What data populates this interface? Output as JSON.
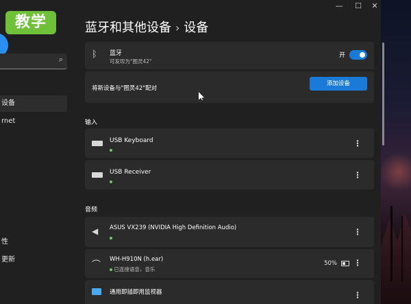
{
  "window": {
    "controls": {
      "minimize": "—",
      "maximize": "☐",
      "close": "✕"
    }
  },
  "badge": {
    "text": "教学",
    "color": "#6fc13a"
  },
  "sidebar": {
    "search_icon": "search-icon",
    "items": [
      {
        "label": "设备",
        "active": true
      },
      {
        "label": "rnet",
        "active": false
      },
      {
        "label": "性",
        "active": false
      },
      {
        "label": "更新",
        "active": false
      }
    ]
  },
  "breadcrumb": {
    "parent": "蓝牙和其他设备",
    "separator": "›",
    "current": "设备"
  },
  "bluetooth": {
    "icon": "bluetooth-icon",
    "title": "蓝牙",
    "subtitle": "可发现为\"图灵42\"",
    "toggle_label": "开",
    "toggle_on": true,
    "accent": "#1a7ad8"
  },
  "pair": {
    "text": "将新设备与\"图灵42\"配对",
    "button": "添加设备"
  },
  "sections": {
    "input": "输入",
    "audio": "音频"
  },
  "input_devices": [
    {
      "name": "USB Keyboard",
      "icon": "keyboard-icon"
    },
    {
      "name": "USB Receiver",
      "icon": "keyboard-icon"
    }
  ],
  "audio_devices": [
    {
      "name": "ASUS VX239 (NVIDIA High Definition Audio)",
      "icon": "speaker-icon",
      "status": ""
    },
    {
      "name": "WH-H910N (h.ear)",
      "icon": "headphones-icon",
      "status": "已连接语音，音乐",
      "battery": "50%",
      "battery_level": 0.5
    },
    {
      "name": "通用即插即用监视器",
      "icon": "monitor-icon",
      "status": ""
    }
  ],
  "status_color": "#6ccb5f"
}
